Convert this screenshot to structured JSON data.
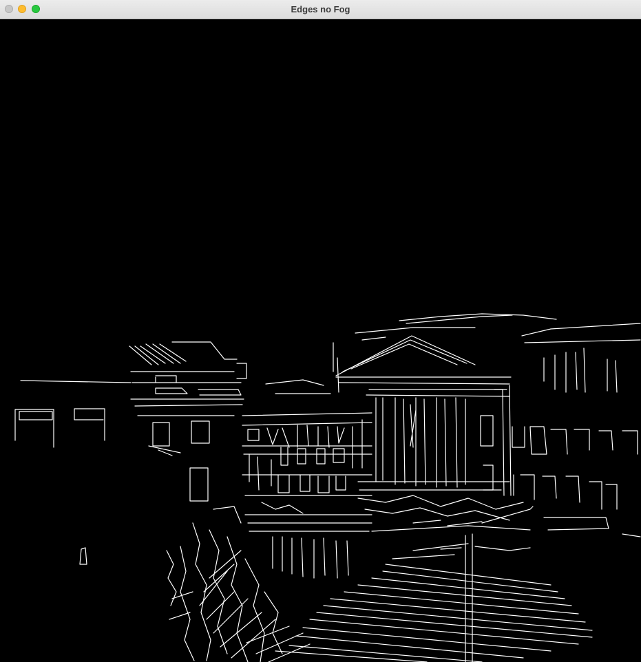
{
  "window": {
    "title": "Edges no Fog",
    "colors": {
      "titlebar": "#e3e3e3",
      "close": "#c7c7c7",
      "minimize": "#febc2e",
      "maximize": "#28c840",
      "background": "#000000",
      "edges": "#ffffff"
    }
  },
  "image": {
    "description_icon": "canny-edge-image"
  }
}
